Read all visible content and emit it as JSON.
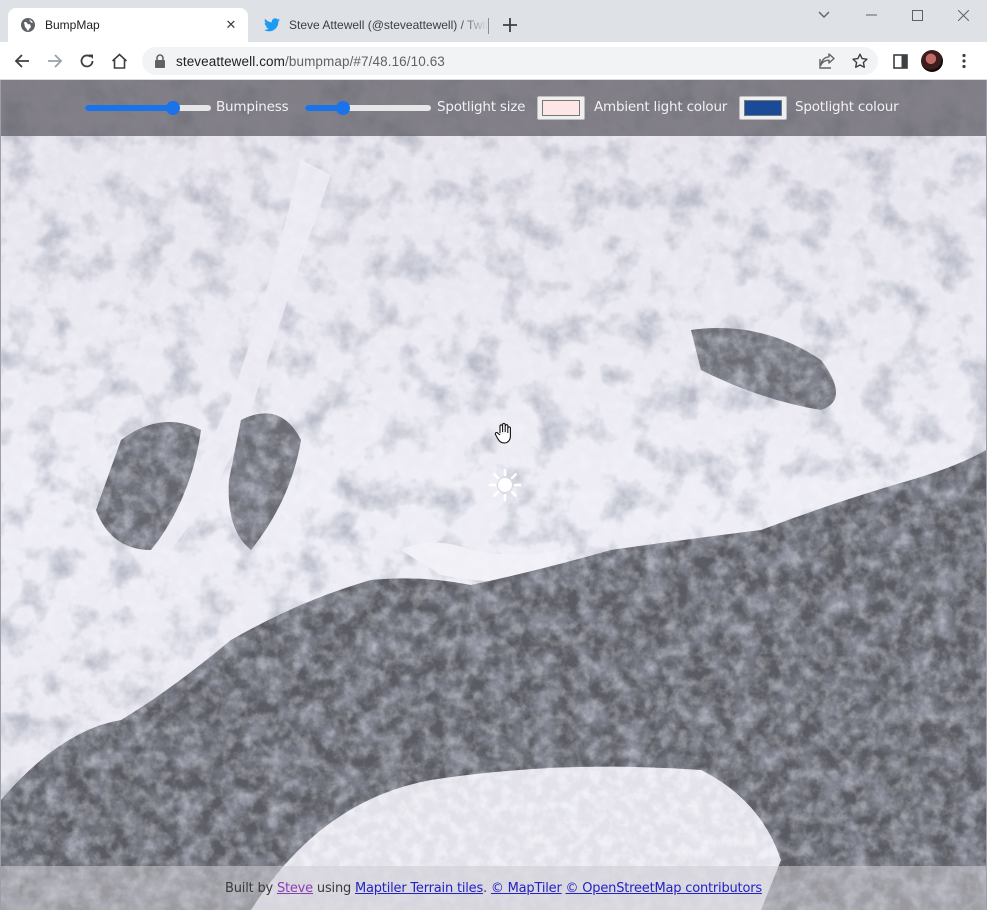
{
  "browser": {
    "tabs": [
      {
        "title": "BumpMap",
        "active": true,
        "icon": "globe-icon"
      },
      {
        "title": "Steve Attewell (@steveattewell) / Twitter",
        "active": false,
        "icon": "twitter-bird-icon"
      }
    ],
    "url": {
      "host": "steveattewell.com",
      "path": "/bumpmap/#7/48.16/10.63"
    }
  },
  "controls": {
    "bumpiness": {
      "label": "Bumpiness",
      "value": 0.72
    },
    "spotlight_size": {
      "label": "Spotlight size",
      "value": 0.28
    },
    "ambient": {
      "label": "Ambient light colour",
      "color": "#fce6e6"
    },
    "spotlight": {
      "label": "Spotlight colour",
      "color": "#1a4b99"
    }
  },
  "footer": {
    "prefix": "Built by ",
    "author": "Steve",
    "using": " using ",
    "tiles": "Maptiler Terrain tiles",
    "sep1": ". ",
    "maptiler": "© MapTiler",
    "sep2": " ",
    "osm": "© OpenStreetMap contributors"
  },
  "colors": {
    "accent": "#1a73e8",
    "author_link": "#8a3fb4",
    "link": "#2323c4"
  }
}
